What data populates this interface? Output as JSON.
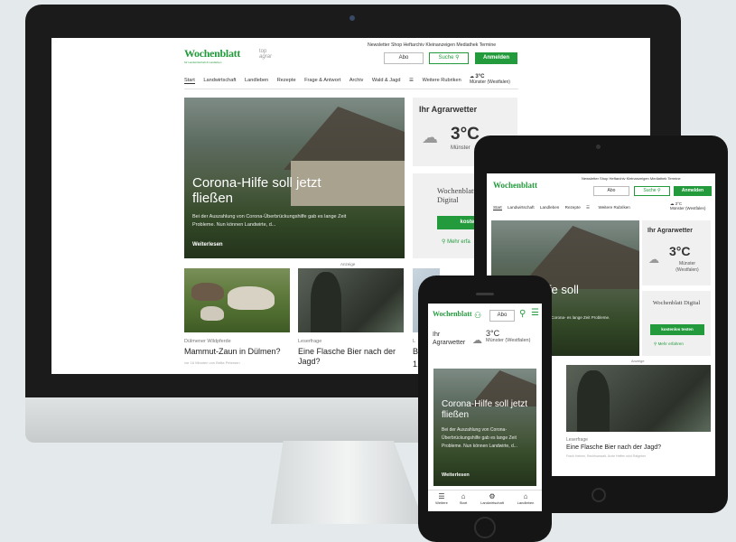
{
  "desktop": {
    "logo": "Wochenblatt",
    "logo_tagline": "für Landwirtschaft & Landleben",
    "partner_logo_line1": "top",
    "partner_logo_line2": "agrar",
    "top_links": [
      "Newsletter",
      "Shop",
      "Heftarchiv",
      "Kleinanzeigen",
      "Mediathek",
      "Termine"
    ],
    "abo_label": "Abo",
    "search_label": "Suche",
    "login_label": "Anmelden",
    "nav": [
      "Start",
      "Landwirtschaft",
      "Landleben",
      "Rezepte",
      "Frage & Antwort",
      "Archiv",
      "Wald & Jagd"
    ],
    "more_label": "Weitere Rubriken",
    "weather_temp": "3°C",
    "weather_place": "Münster (Westfalen)",
    "hero_title": "Corona-Hilfe soll jetzt fließen",
    "hero_text": "Bei der Auszahlung von Corona-Überbrückungshilfe gab es lange Zeit Probleme. Nun können Landwirte, d...",
    "hero_link": "Weiterlesen",
    "agrarwetter_title": "Ihr Agrarwetter",
    "agrarwetter_temp": "3°C",
    "agrarwetter_place": "Münster",
    "digital_title": "Wochenblatt Digital",
    "digital_btn": "kostenlos te",
    "digital_more": "Mehr erfa",
    "ad_label": "Anzeige",
    "card1_kicker": "Dülmener Wildpferde",
    "card1_title": "Mammut-Zaun in Dülmen?",
    "card1_meta": "vor 16 Minuten von Britta Petersen",
    "card2_kicker": "Leserfrage",
    "card2_title": "Eine Flasche Bier nach der Jagd?",
    "card3_kicker": "L",
    "card3_title": "B",
    "card3_line": "1."
  },
  "tablet": {
    "logo": "Wochenblatt",
    "top_links": [
      "Newsletter",
      "Shop",
      "Heftarchiv",
      "Kleinanzeigen",
      "Mediathek",
      "Termine"
    ],
    "abo_label": "Abo",
    "search_label": "Suche",
    "login_label": "Anmelden",
    "nav": [
      "Start",
      "Landwirtschaft",
      "Landleben",
      "Rezepte"
    ],
    "more_label": "Weitere Rubriken",
    "weather_temp": "3°C",
    "weather_place": "Münster (Westfalen)",
    "hero_title_partial": "ife soll",
    "hero_title_partial2": "n",
    "hero_text": "on Corona- es lange Zeit Probleme.",
    "agrarwetter_title": "Ihr Agrarwetter",
    "agrarwetter_temp": "3°C",
    "agrarwetter_place": "Münster (Westfalen)",
    "digital_title": "Wochenblatt Digital",
    "digital_btn": "kostenlos testen",
    "digital_more": "Mehr erfahren",
    "ad_label": "Anzeige",
    "card_kicker": "Leserfrage",
    "card_title": "Eine Flasche Bier nach der Jagd?",
    "card_meta": "Frank Heinen, Rechtsanwalt, Ärzte Heffen wird Ratgeber"
  },
  "phone": {
    "logo": "Wochenblatt",
    "abo_label": "Abo",
    "weather_label": "Ihr Agrarwetter",
    "weather_temp": "3°C",
    "weather_place": "Münster (Westfalen)",
    "hero_title": "Corona-Hilfe soll jetzt fließen",
    "hero_text": "Bei der Auszahlung von Corona-Überbrückungshilfe gab es lange Zeit Probleme. Nun können Landwirte, d...",
    "hero_link": "Weiterlesen",
    "tabbar": [
      "Weitere",
      "Start",
      "Landwirtschaft",
      "Landleben"
    ]
  },
  "colors": {
    "brand_green": "#239b3c",
    "device_black": "#1b1b1b",
    "background": "#e4e9eb"
  }
}
